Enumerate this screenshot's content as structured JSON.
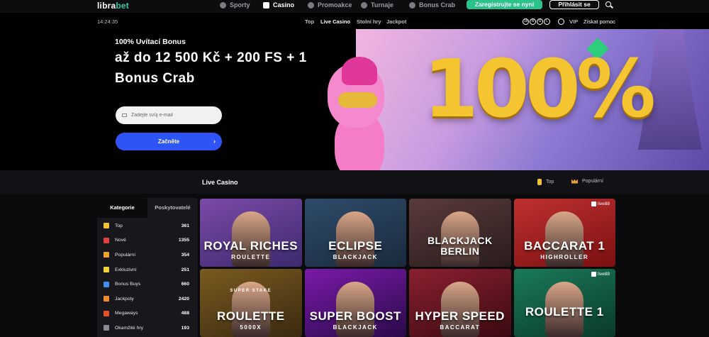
{
  "brand": {
    "logo_part1": "libra",
    "logo_part2": "bet"
  },
  "nav": {
    "items": [
      {
        "label": "Sporty",
        "icon": "sport-icon"
      },
      {
        "label": "Casino",
        "icon": "casino-icon",
        "active": true
      },
      {
        "label": "Promoakce",
        "icon": "promo-icon"
      },
      {
        "label": "Turnaje",
        "icon": "trophy-icon"
      },
      {
        "label": "Bonus Crab",
        "icon": "crab-icon"
      }
    ],
    "register_label": "Zaregistrujte se nyní",
    "login_label": "Přihlásit se"
  },
  "subbar": {
    "clock": "14:24:35",
    "tabs": [
      "Top",
      "Live Casino",
      "Stolní hry",
      "Jackpot"
    ],
    "vip_label": "VIP",
    "help_label": "Získat pomoc"
  },
  "hero": {
    "bonus_small": "100% Uvítací Bonus",
    "bonus_big": "až do 12 500 Kč + 200 FS + 1 Bonus Crab",
    "email_placeholder": "Zadejte svůj e-mail",
    "start_label": "Začněte",
    "start_arrow": "›",
    "banner_text": "100%"
  },
  "section": {
    "title": "Live Casino",
    "links": [
      {
        "label": "Top",
        "icon": "coin-icon"
      },
      {
        "label": "Populární",
        "icon": "crown-icon"
      }
    ]
  },
  "sidebar": {
    "tabs": [
      "Kategorie",
      "Poskytovatelé"
    ],
    "categories": [
      {
        "label": "Top",
        "count": "361",
        "color": "#f0c23a"
      },
      {
        "label": "Nové",
        "count": "1355",
        "color": "#e24040"
      },
      {
        "label": "Populární",
        "count": "354",
        "color": "#f0a32a"
      },
      {
        "label": "Exkluzivní",
        "count": "251",
        "color": "#f6d23a"
      },
      {
        "label": "Bonus Buys",
        "count": "660",
        "color": "#3a8ef0"
      },
      {
        "label": "Jackpoty",
        "count": "2420",
        "color": "#f08a2a"
      },
      {
        "label": "Megaways",
        "count": "488",
        "color": "#e0502a"
      },
      {
        "label": "Okamžité hry",
        "count": "193",
        "color": "#8a8a95"
      }
    ]
  },
  "games": [
    {
      "title": "ROYAL RICHES",
      "sub": "ROULETTE",
      "bg1": "#3c2a6e",
      "bg2": "#7b4aa8"
    },
    {
      "title": "ECLIPSE",
      "sub": "BLACKJACK",
      "bg1": "#1a2a3c",
      "bg2": "#2e4b6a"
    },
    {
      "title": "BLACKJACK BERLIN",
      "sub": "",
      "bg1": "#2a1c1c",
      "bg2": "#5a3a3a"
    },
    {
      "title": "BACCARAT 1",
      "sub": "HIGHROLLER",
      "bg1": "#7a1010",
      "bg2": "#c03030",
      "badge": "live88"
    },
    {
      "title": "ROULETTE",
      "sub": "5000X",
      "top": "SUPER STAKE",
      "bg1": "#3a2a10",
      "bg2": "#7a5a20"
    },
    {
      "title": "SUPER BOOST",
      "sub": "BLACKJACK",
      "bg1": "#2a0a4a",
      "bg2": "#7a1aa8"
    },
    {
      "title": "HYPER SPEED",
      "sub": "BACCARAT",
      "bg1": "#3a0a10",
      "bg2": "#8a2030"
    },
    {
      "title": "ROULETTE 1",
      "sub": "",
      "bg1": "#0a3a2a",
      "bg2": "#1a7a5a",
      "badge": "live88"
    }
  ]
}
